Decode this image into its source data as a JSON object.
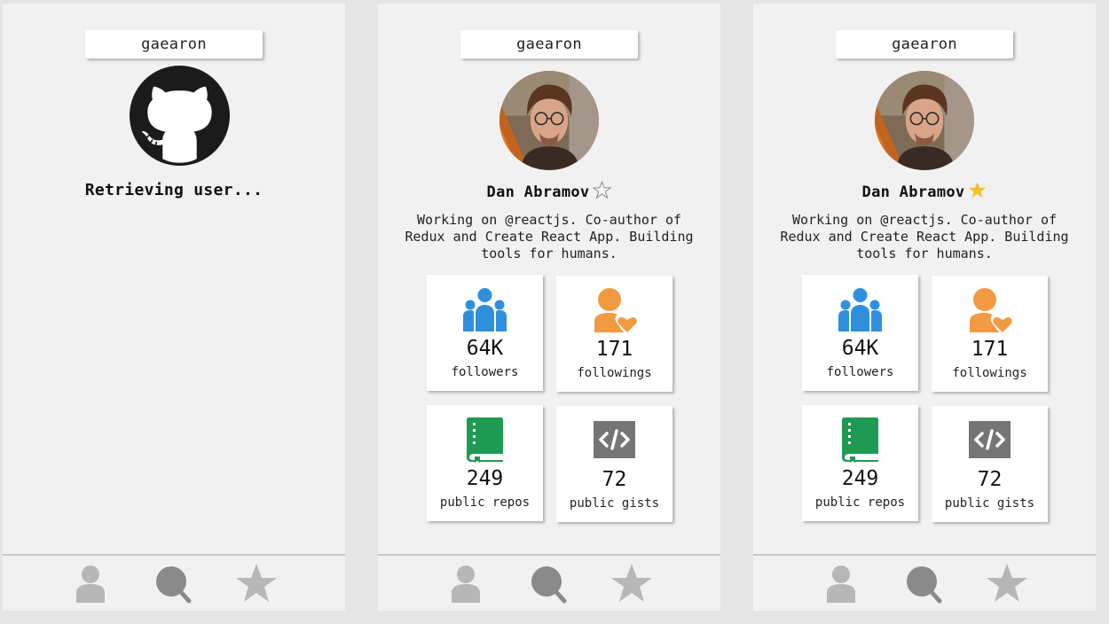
{
  "screens": [
    {
      "username": "gaearon",
      "loading_text": "Retrieving user..."
    },
    {
      "username": "gaearon",
      "name": "Dan Abramov",
      "favorited": false,
      "bio": "Working on @reactjs. Co-author of Redux and Create React App. Building tools for humans.",
      "stats": {
        "followers": {
          "value": "64K",
          "label": "followers"
        },
        "followings": {
          "value": "171",
          "label": "followings"
        },
        "repos": {
          "value": "249",
          "label": "public repos"
        },
        "gists": {
          "value": "72",
          "label": "public gists"
        }
      }
    },
    {
      "username": "gaearon",
      "name": "Dan Abramov",
      "favorited": true,
      "bio": "Working on @reactjs. Co-author of Redux and Create React App. Building tools for humans.",
      "stats": {
        "followers": {
          "value": "64K",
          "label": "followers"
        },
        "followings": {
          "value": "171",
          "label": "followings"
        },
        "repos": {
          "value": "249",
          "label": "public repos"
        },
        "gists": {
          "value": "72",
          "label": "public gists"
        }
      }
    }
  ],
  "tabs": [
    {
      "icon": "user-icon"
    },
    {
      "icon": "search-icon"
    },
    {
      "icon": "star-icon"
    }
  ],
  "colors": {
    "followers_icon": "#2f8fdd",
    "followings_icon": "#f29a42",
    "repos_icon": "#1f9a52",
    "gists_icon": "#757575",
    "star_active": "#f6c02e",
    "star_inactive": "#d4d4d4",
    "tab_icon": "#b7b7b7",
    "tab_icon_active": "#8a8a8a"
  }
}
